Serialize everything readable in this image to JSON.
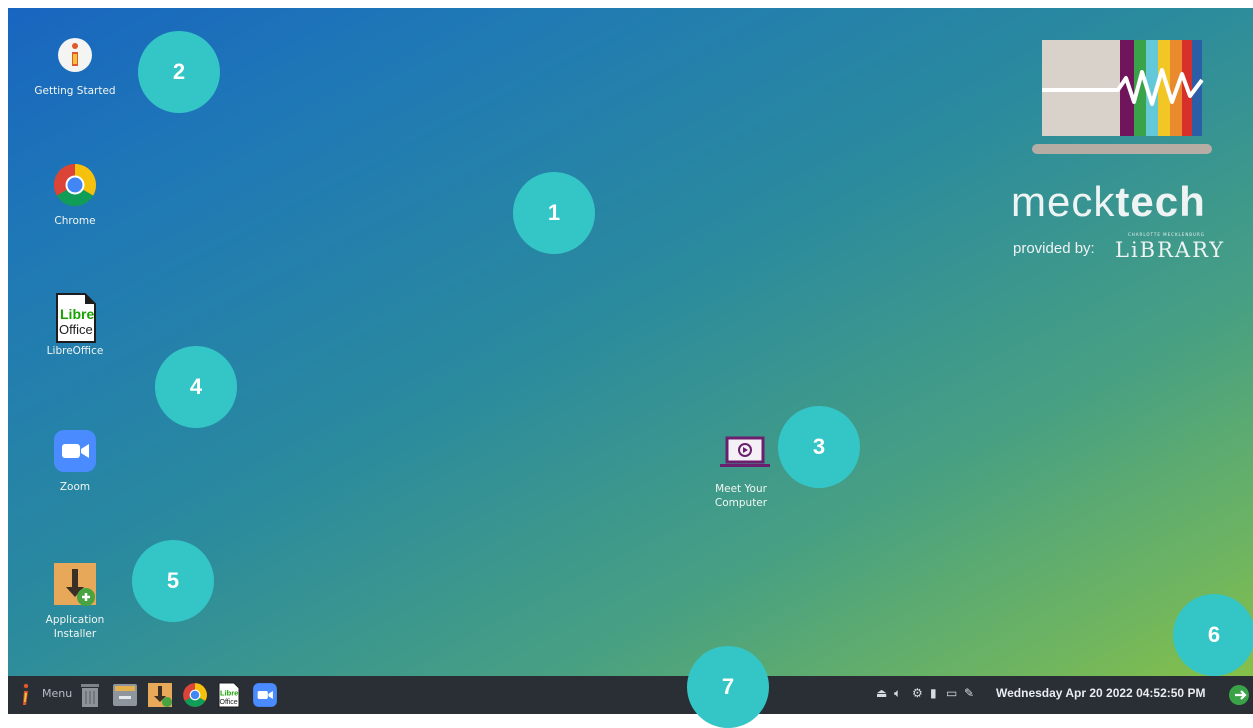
{
  "desktop": {
    "icons": [
      {
        "label": "Getting Started"
      },
      {
        "label": "Chrome"
      },
      {
        "label": "LibreOffice"
      },
      {
        "label": "Zoom"
      },
      {
        "label": "Application Installer"
      },
      {
        "label": "Meet Your Computer"
      }
    ],
    "brand": {
      "word_light": "meck",
      "word_bold": "tech",
      "provided_by": "provided by:",
      "library_small": "CHARLOTTE MECKLENBURG",
      "library": "LiBRARY"
    }
  },
  "callouts": [
    "1",
    "2",
    "3",
    "4",
    "5",
    "6",
    "7"
  ],
  "taskbar": {
    "menu_label": "Menu",
    "clock": "Wednesday Apr 20 2022 04:52:50 PM",
    "tray_icons": [
      "eject-icon",
      "volume-icon",
      "network-icon",
      "battery-icon",
      "display-icon",
      "clip-icon"
    ],
    "launchers": [
      "menu-icon",
      "trash-icon",
      "file-manager-icon",
      "app-installer-icon",
      "chrome-icon",
      "libreoffice-icon",
      "zoom-icon"
    ]
  },
  "colors": {
    "callout": "#34c6c6",
    "taskbar": "#2a2f36",
    "desktop_top": "#1865c0",
    "desktop_bottom": "#8cc440"
  }
}
